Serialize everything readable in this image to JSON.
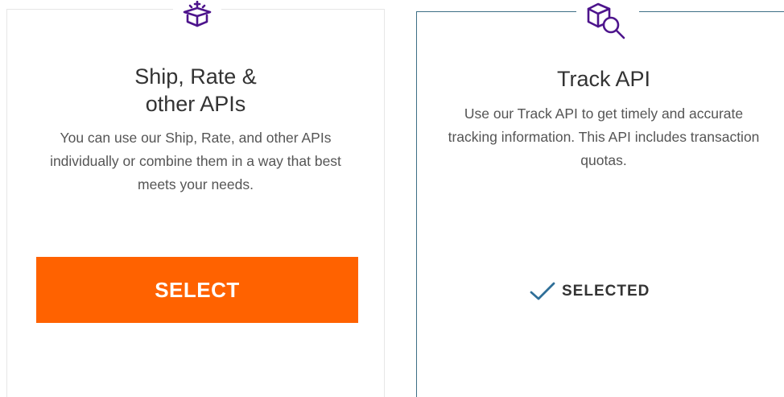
{
  "cards": [
    {
      "icon": "gift-box-icon",
      "title_line1": "Ship, Rate &",
      "title_line2": "other APIs",
      "description": "You can use our Ship, Rate, and other APIs individually or combine them in a way that best meets your needs.",
      "button_label": "SELECT"
    },
    {
      "icon": "box-search-icon",
      "title": "Track API",
      "description": "Use our Track API to get timely and accurate tracking information. This API includes transaction quotas.",
      "status_label": "SELECTED",
      "status_icon": "checkmark-icon"
    }
  ],
  "colors": {
    "accent_orange": "#ff6200",
    "icon_purple": "#4d148c",
    "selected_border": "#3e6f86",
    "check_blue": "#2f6f98",
    "text_dark": "#333333",
    "text_body": "#555555"
  }
}
